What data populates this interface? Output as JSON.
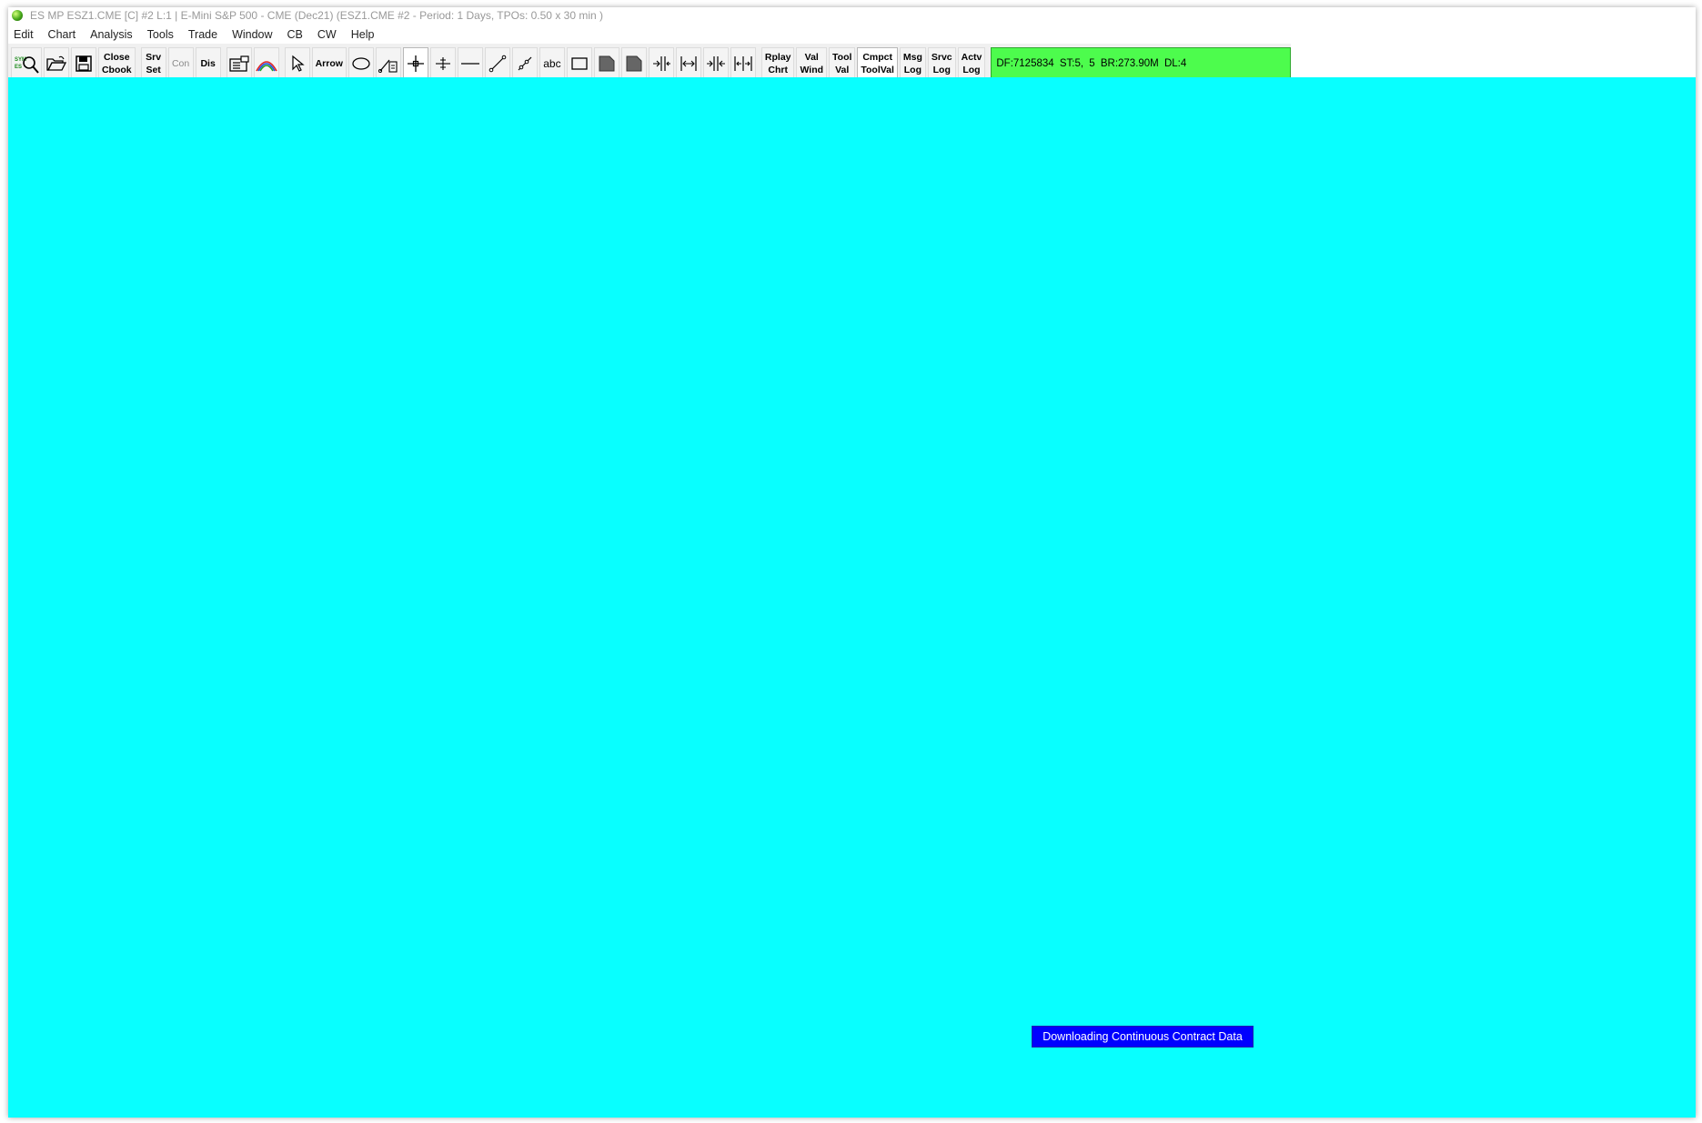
{
  "window": {
    "title": "ES MP ESZ1.CME [C]  #2 L:1 | E-Mini S&P 500 - CME (Dec21) (ESZ1.CME  #2 - Period: 1 Days, TPOs: 0.50 x 30 min  )"
  },
  "menu": [
    "Edit",
    "Chart",
    "Analysis",
    "Tools",
    "Trade",
    "Window",
    "CB",
    "CW",
    "Help"
  ],
  "toolbar": {
    "close_cbook": "Close\nCbook",
    "srv_set": "Srv\nSet",
    "con": "Con",
    "dis": "Dis",
    "arrow": "Arrow",
    "abc": "abc",
    "rplay_chrt": "Rplay\nChrt",
    "val_wind": "Val\nWind",
    "tool_val": "Tool\nVal",
    "cmpct_toolval": "Cmpct\nToolVal",
    "msg_log": "Msg\nLog",
    "srvc_log": "Srvc\nLog",
    "actv_log": "Actv\nLog",
    "status": "DF:7125834  ST:5, 5  BR:273.90M  DL:4"
  },
  "symbol_icon": {
    "top": "SYM",
    "bottom": "ES"
  },
  "chart": {
    "background": "#08ffff",
    "message": "Downloading Continuous Contract Data"
  },
  "colors": {
    "status_green": "#4dfc4d",
    "message_blue": "#0000ff"
  }
}
